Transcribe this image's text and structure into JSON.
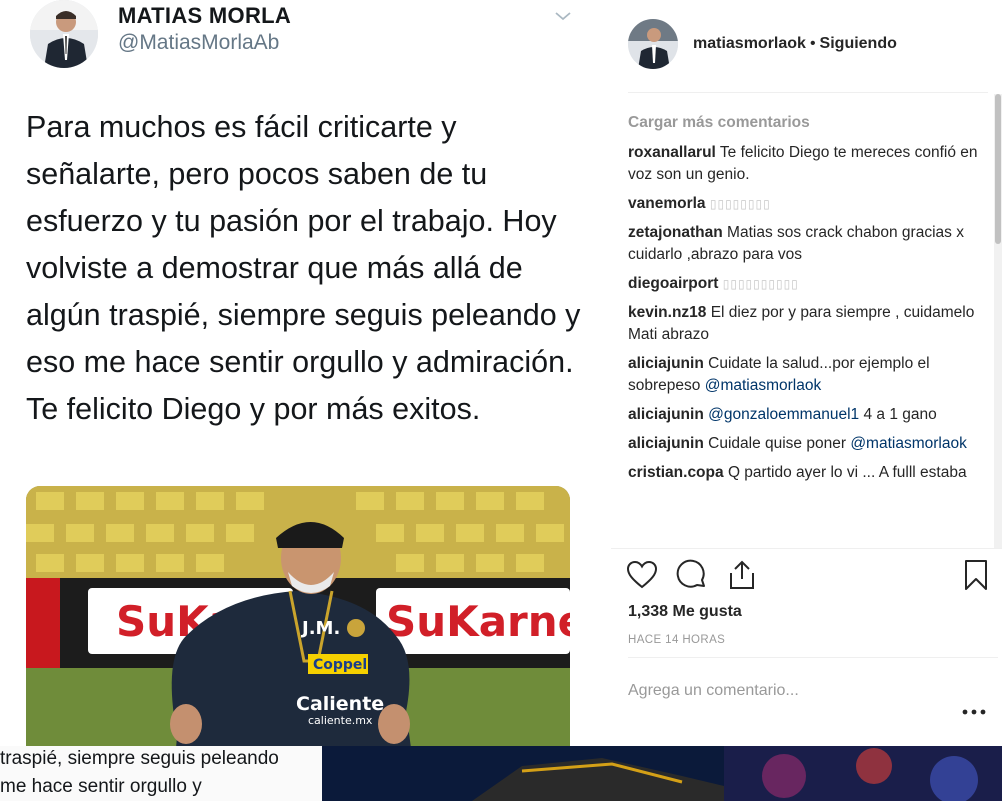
{
  "tweet": {
    "name": "MATIAS MORLA",
    "handle": "@MatiasMorlaAb",
    "text": "Para muchos es fácil criticarte y señalarte, pero pocos saben de tu esfuerzo y tu pasión por el trabajo. Hoy volviste a demostrar que más allá de algún traspié, siempre seguis peleando y eso me hace sentir orgullo y admiración. Te felicito Diego y por más exitos.",
    "photo_banner_left": "SuKarne",
    "photo_banner_right": "SuKarne",
    "shirt_text_1": "Coppel",
    "shirt_text_2": "Caliente",
    "shirt_text_3": "caliente.mx",
    "shirt_initials": "J.M."
  },
  "post": {
    "username": "matiasmorlaok",
    "separator": "•",
    "follow_status": "Siguiendo",
    "load_more": "Cargar más comentarios",
    "comments": [
      {
        "user": "roxanallarul",
        "text": "Te felicito Diego te mereces confió en voz son un genio."
      },
      {
        "user": "vanemorla",
        "boxes": "▯▯▯▯▯▯▯▯"
      },
      {
        "user": "zetajonathan",
        "text": "Matias sos crack chabon gracias x cuidarlo ,abrazo para vos"
      },
      {
        "user": "diegoairport",
        "boxes": "▯▯▯▯▯▯▯▯▯▯"
      },
      {
        "user": "kevin.nz18",
        "text": "El diez por y para siempre , cuidamelo Mati abrazo"
      },
      {
        "user": "aliciajunin",
        "text": "Cuidate la salud...por ejemplo el sobrepeso",
        "mention": "@matiasmorlaok"
      },
      {
        "user": "aliciajunin",
        "mention_first": "@gonzaloemmanuel1",
        "text": "4 a 1 gano"
      },
      {
        "user": "aliciajunin",
        "text": "Cuidale quise poner",
        "mention": "@matiasmorlaok"
      },
      {
        "user": "cristian.copa",
        "text": "Q partido ayer lo vi ... A fulll estaba"
      }
    ],
    "likes": "1,338 Me gusta",
    "time": "HACE 14 HORAS",
    "add_comment_placeholder": "Agrega un comentario..."
  },
  "bottom_strip": {
    "line1": "traspié, siempre seguis peleando",
    "line2": "me hace sentir orgullo y"
  },
  "colors": {
    "text_dark": "#262626",
    "muted": "#999999",
    "mention": "#003569",
    "twitter_gray": "#657786"
  }
}
